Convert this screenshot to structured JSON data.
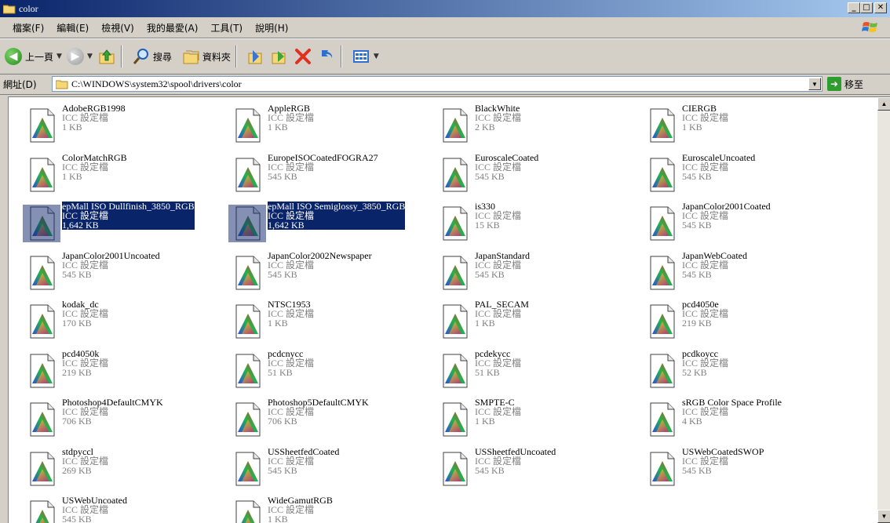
{
  "window": {
    "title": "color"
  },
  "menu": [
    "檔案(F)",
    "編輯(E)",
    "檢視(V)",
    "我的最愛(A)",
    "工具(T)",
    "說明(H)"
  ],
  "toolbar": {
    "back": "上一頁",
    "search": "搜尋",
    "folders": "資料夾"
  },
  "address": {
    "label": "網址(D)",
    "path": "C:\\WINDOWS\\system32\\spool\\drivers\\color",
    "go": "移至"
  },
  "files": [
    {
      "name": "AdobeRGB1998",
      "type": "ICC 設定檔",
      "size": "1 KB"
    },
    {
      "name": "AppleRGB",
      "type": "ICC 設定檔",
      "size": "1 KB"
    },
    {
      "name": "BlackWhite",
      "type": "ICC 設定檔",
      "size": "2 KB"
    },
    {
      "name": "CIERGB",
      "type": "ICC 設定檔",
      "size": "1 KB"
    },
    {
      "name": "ColorMatchRGB",
      "type": "ICC 設定檔",
      "size": "1 KB"
    },
    {
      "name": "EuropeISOCoatedFOGRA27",
      "type": "ICC 設定檔",
      "size": "545 KB"
    },
    {
      "name": "EuroscaleCoated",
      "type": "ICC 設定檔",
      "size": "545 KB"
    },
    {
      "name": "EuroscaleUncoated",
      "type": "ICC 設定檔",
      "size": "545 KB"
    },
    {
      "name": "epMall ISO Dullfinish_3850_RGB",
      "type": "ICC 設定檔",
      "size": "1,642 KB",
      "selected": true
    },
    {
      "name": "epMall ISO Semiglossy_3850_RGB",
      "type": "ICC 設定檔",
      "size": "1,642 KB",
      "selected": true
    },
    {
      "name": "is330",
      "type": "ICC 設定檔",
      "size": "15 KB"
    },
    {
      "name": "JapanColor2001Coated",
      "type": "ICC 設定檔",
      "size": "545 KB"
    },
    {
      "name": "JapanColor2001Uncoated",
      "type": "ICC 設定檔",
      "size": "545 KB"
    },
    {
      "name": "JapanColor2002Newspaper",
      "type": "ICC 設定檔",
      "size": "545 KB"
    },
    {
      "name": "JapanStandard",
      "type": "ICC 設定檔",
      "size": "545 KB"
    },
    {
      "name": "JapanWebCoated",
      "type": "ICC 設定檔",
      "size": "545 KB"
    },
    {
      "name": "kodak_dc",
      "type": "ICC 設定檔",
      "size": "170 KB"
    },
    {
      "name": "NTSC1953",
      "type": "ICC 設定檔",
      "size": "1 KB"
    },
    {
      "name": "PAL_SECAM",
      "type": "ICC 設定檔",
      "size": "1 KB"
    },
    {
      "name": "pcd4050e",
      "type": "ICC 設定檔",
      "size": "219 KB"
    },
    {
      "name": "pcd4050k",
      "type": "ICC 設定檔",
      "size": "219 KB"
    },
    {
      "name": "pcdcnycc",
      "type": "ICC 設定檔",
      "size": "51 KB"
    },
    {
      "name": "pcdekycc",
      "type": "ICC 設定檔",
      "size": "51 KB"
    },
    {
      "name": "pcdkoycc",
      "type": "ICC 設定檔",
      "size": "52 KB"
    },
    {
      "name": "Photoshop4DefaultCMYK",
      "type": "ICC 設定檔",
      "size": "706 KB"
    },
    {
      "name": "Photoshop5DefaultCMYK",
      "type": "ICC 設定檔",
      "size": "706 KB"
    },
    {
      "name": "SMPTE-C",
      "type": "ICC 設定檔",
      "size": "1 KB"
    },
    {
      "name": "sRGB Color Space Profile",
      "type": "ICC 設定檔",
      "size": "4 KB"
    },
    {
      "name": "stdpyccl",
      "type": "ICC 設定檔",
      "size": "269 KB"
    },
    {
      "name": "USSheetfedCoated",
      "type": "ICC 設定檔",
      "size": "545 KB"
    },
    {
      "name": "USSheetfedUncoated",
      "type": "ICC 設定檔",
      "size": "545 KB"
    },
    {
      "name": "USWebCoatedSWOP",
      "type": "ICC 設定檔",
      "size": "545 KB"
    },
    {
      "name": "USWebUncoated",
      "type": "ICC 設定檔",
      "size": "545 KB"
    },
    {
      "name": "WideGamutRGB",
      "type": "ICC 設定檔",
      "size": "1 KB"
    }
  ]
}
